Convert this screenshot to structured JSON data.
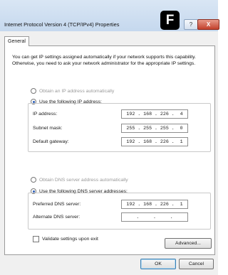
{
  "window": {
    "title": "Internet Protocol Version 4 (TCP/IPv4) Properties",
    "help_label": "?",
    "close_label": "X"
  },
  "badge": {
    "letter": "F"
  },
  "tab": {
    "label": "General"
  },
  "description": "You can get IP settings assigned automatically if your network supports this capability. Otherwise, you need to ask your network administrator for the appropriate IP settings.",
  "ip": {
    "auto_label": "Obtain an IP address automatically",
    "manual_label": "Use the following IP address:",
    "selected": "manual",
    "fields": [
      {
        "label": "IP address:",
        "value": "192 . 168 . 226 .  4"
      },
      {
        "label": "Subnet mask:",
        "value": "255 . 255 . 255 .  0"
      },
      {
        "label": "Default gateway:",
        "value": "192 . 168 . 226 .  1"
      }
    ]
  },
  "dns": {
    "auto_label": "Obtain DNS server address automatically",
    "manual_label": "Use the following DNS server addresses:",
    "selected": "manual",
    "fields": [
      {
        "label": "Preferred DNS server:",
        "value": "192 . 168 . 226 .  1"
      },
      {
        "label": "Alternate DNS server:",
        "value": "  .     .     .  "
      }
    ]
  },
  "validate": {
    "label": "Validate settings upon exit",
    "checked": false
  },
  "buttons": {
    "advanced": "Advanced...",
    "ok": "OK",
    "cancel": "Cancel"
  }
}
